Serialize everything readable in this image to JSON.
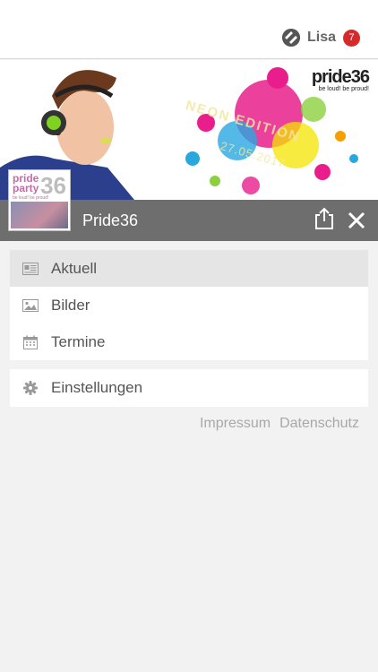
{
  "header": {
    "user_name": "Lisa",
    "notification_count": "7"
  },
  "banner": {
    "brand": "pride36",
    "brand_tagline": "be loud! be proud!",
    "edition_text": "NEON EDITION",
    "edition_date": "27.05.2017"
  },
  "group": {
    "title": "Pride36",
    "thumb_line1": "pride",
    "thumb_line2": "party",
    "thumb_number": "36",
    "thumb_tagline": "be loud! be proud!"
  },
  "menu": {
    "items": [
      {
        "label": "Aktuell",
        "icon": "newspaper-icon",
        "active": true
      },
      {
        "label": "Bilder",
        "icon": "image-icon",
        "active": false
      },
      {
        "label": "Termine",
        "icon": "calendar-icon",
        "active": false
      }
    ],
    "settings_label": "Einstellungen"
  },
  "footer": {
    "impressum": "Impressum",
    "datenschutz": "Datenschutz"
  },
  "colors": {
    "titlebar_bg": "#6e6e6e",
    "badge_bg": "#d62a2a",
    "active_bg": "#e5e5e5"
  }
}
